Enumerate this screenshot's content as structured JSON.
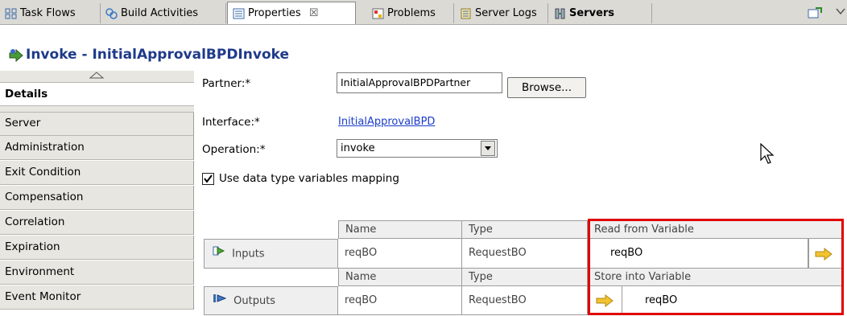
{
  "tabs": [
    {
      "label": "Task Flows",
      "icon": "task-flows-icon",
      "bold": false
    },
    {
      "label": "Build Activities",
      "icon": "build-activities-icon",
      "bold": false
    },
    {
      "label": "Properties",
      "icon": "properties-icon",
      "bold": false,
      "active": true
    },
    {
      "label": "Problems",
      "icon": "problems-icon",
      "bold": false
    },
    {
      "label": "Server Logs",
      "icon": "server-logs-icon",
      "bold": false
    },
    {
      "label": "Servers",
      "icon": "servers-icon",
      "bold": true
    }
  ],
  "tab_close_glyph": "☒",
  "title": "Invoke - InitialApprovalBPDInvoke",
  "nav": {
    "items": [
      "Details",
      "Server",
      "Administration",
      "Exit Condition",
      "Compensation",
      "Correlation",
      "Expiration",
      "Environment",
      "Event Monitor"
    ],
    "selected": "Details"
  },
  "form": {
    "partner_label": "Partner:*",
    "partner_value": "InitialApprovalBPDPartner",
    "browse_label": "Browse...",
    "interface_label": "Interface:*",
    "interface_value": "InitialApprovalBPD",
    "operation_label": "Operation:*",
    "operation_value": "invoke",
    "checkbox_label": "Use data type variables mapping",
    "checkbox_checked": true
  },
  "table": {
    "inputs": {
      "row_label": "Inputs",
      "headers": [
        "Name",
        "Type",
        "Read from Variable"
      ],
      "name": "reqBO",
      "type": "RequestBO",
      "variable": "reqBO"
    },
    "outputs": {
      "row_label": "Outputs",
      "headers": [
        "Name",
        "Type",
        "Store into Variable"
      ],
      "name": "reqBO",
      "type": "RequestBO",
      "variable": "reqBO"
    }
  },
  "colors": {
    "title": "#1f3a8a",
    "highlight_box": "#e00000",
    "arrow": "#f2c230",
    "link": "#1a3cc9"
  }
}
